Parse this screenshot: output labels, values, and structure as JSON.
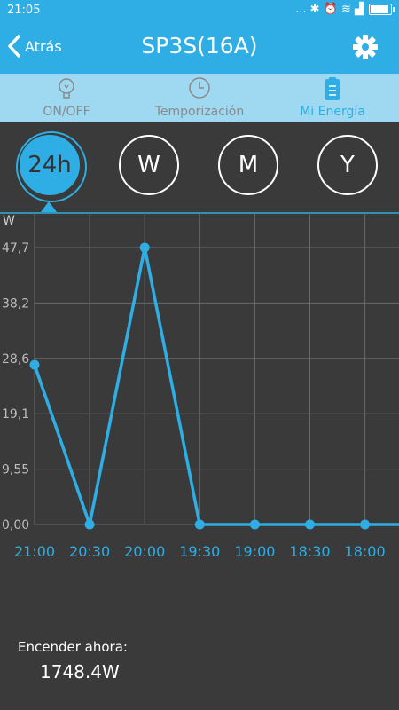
{
  "status": {
    "time": "21:05",
    "icons": "... ✱ ⏰ ≋ ▟",
    "battery_level": 0.85
  },
  "app": {
    "back_label": "Atrás",
    "title": "SP3S(16A)"
  },
  "tabs": [
    {
      "label": "ON/OFF",
      "icon": "lightbulb-icon"
    },
    {
      "label": "Temporización",
      "icon": "clock-icon"
    },
    {
      "label": "Mi Energía",
      "icon": "clipboard-icon",
      "active": true
    }
  ],
  "periods": [
    "24h",
    "W",
    "M",
    "Y"
  ],
  "colors": {
    "accent": "#2eaee4",
    "background": "#3a3a3a",
    "tab_bar": "#9fd8f1"
  },
  "chart_data": {
    "type": "line",
    "ylabel": "W",
    "ytick_labels": [
      "0,00",
      "9,55",
      "19,1",
      "28,6",
      "38,2",
      "47,7"
    ],
    "ylim": [
      0,
      51
    ],
    "categories": [
      "21:00",
      "20:30",
      "20:00",
      "19:30",
      "19:00",
      "18:30",
      "18:00"
    ],
    "values": [
      27.5,
      0,
      47.7,
      0,
      0,
      0,
      0
    ],
    "grid": true
  },
  "footer": {
    "label": "Encender ahora:",
    "value": "1748.4W"
  }
}
